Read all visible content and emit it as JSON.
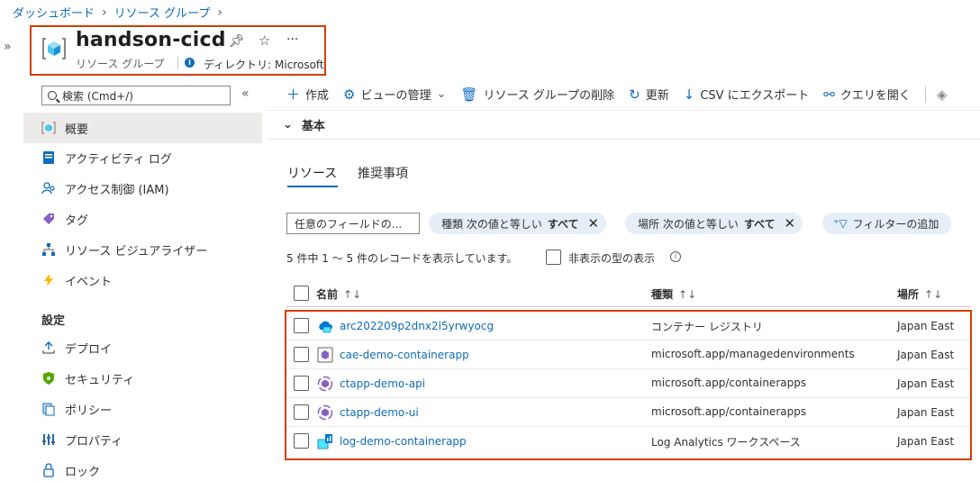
{
  "breadcrumb": [
    "ダッシュボード",
    "リソース グループ"
  ],
  "header": {
    "title": "handson-cicd",
    "subtitle": "リソース グループ",
    "directory": "ディレクトリ: Microsoft"
  },
  "sidebar": {
    "search_placeholder": "検索 (Cmd+/)",
    "items": [
      {
        "label": "概要",
        "icon": "overview-icon"
      },
      {
        "label": "アクティビティ ログ",
        "icon": "activity-log-icon"
      },
      {
        "label": "アクセス制御 (IAM)",
        "icon": "iam-icon"
      },
      {
        "label": "タグ",
        "icon": "tag-icon"
      },
      {
        "label": "リソース ビジュアライザー",
        "icon": "visualizer-icon"
      },
      {
        "label": "イベント",
        "icon": "event-icon"
      }
    ],
    "section_title": "設定",
    "settings_items": [
      {
        "label": "デプロイ",
        "icon": "deploy-icon"
      },
      {
        "label": "セキュリティ",
        "icon": "security-icon"
      },
      {
        "label": "ポリシー",
        "icon": "policy-icon"
      },
      {
        "label": "プロパティ",
        "icon": "properties-icon"
      },
      {
        "label": "ロック",
        "icon": "lock-icon"
      }
    ]
  },
  "toolbar": {
    "create": "作成",
    "manage_view": "ビューの管理",
    "delete_group": "リソース グループの削除",
    "refresh": "更新",
    "export_csv": "CSV にエクスポート",
    "open_query": "クエリを開く"
  },
  "essentials": "基本",
  "tabs": [
    "リソース",
    "推奨事項"
  ],
  "filters": {
    "field_placeholder": "任意のフィールドの...",
    "type_pill": {
      "prefix": "種類 次の値と等しい",
      "value": "すべて"
    },
    "location_pill": {
      "prefix": "場所 次の値と等しい",
      "value": "すべて"
    },
    "add_filter": "フィルターの追加"
  },
  "records_text": "5 件中 1 〜 5 件のレコードを表示しています。",
  "show_hidden": "非表示の型の表示",
  "table": {
    "headers": {
      "name": "名前",
      "type": "種類",
      "location": "場所"
    },
    "rows": [
      {
        "name": "arc202209p2dnx2l5yrwyocg",
        "type": "コンテナー レジストリ",
        "location": "Japan East",
        "icon": "container-registry-icon"
      },
      {
        "name": "cae-demo-containerapp",
        "type": "microsoft.app/managedenvironments",
        "location": "Japan East",
        "icon": "managed-environment-icon"
      },
      {
        "name": "ctapp-demo-api",
        "type": "microsoft.app/containerapps",
        "location": "Japan East",
        "icon": "container-app-icon"
      },
      {
        "name": "ctapp-demo-ui",
        "type": "microsoft.app/containerapps",
        "location": "Japan East",
        "icon": "container-app-icon"
      },
      {
        "name": "log-demo-containerapp",
        "type": "Log Analytics ワークスペース",
        "location": "Japan East",
        "icon": "log-analytics-icon"
      }
    ]
  },
  "colors": {
    "accent": "#0f6cbd",
    "highlight_border": "#d83b01",
    "pill_bg": "#e6eef8"
  }
}
